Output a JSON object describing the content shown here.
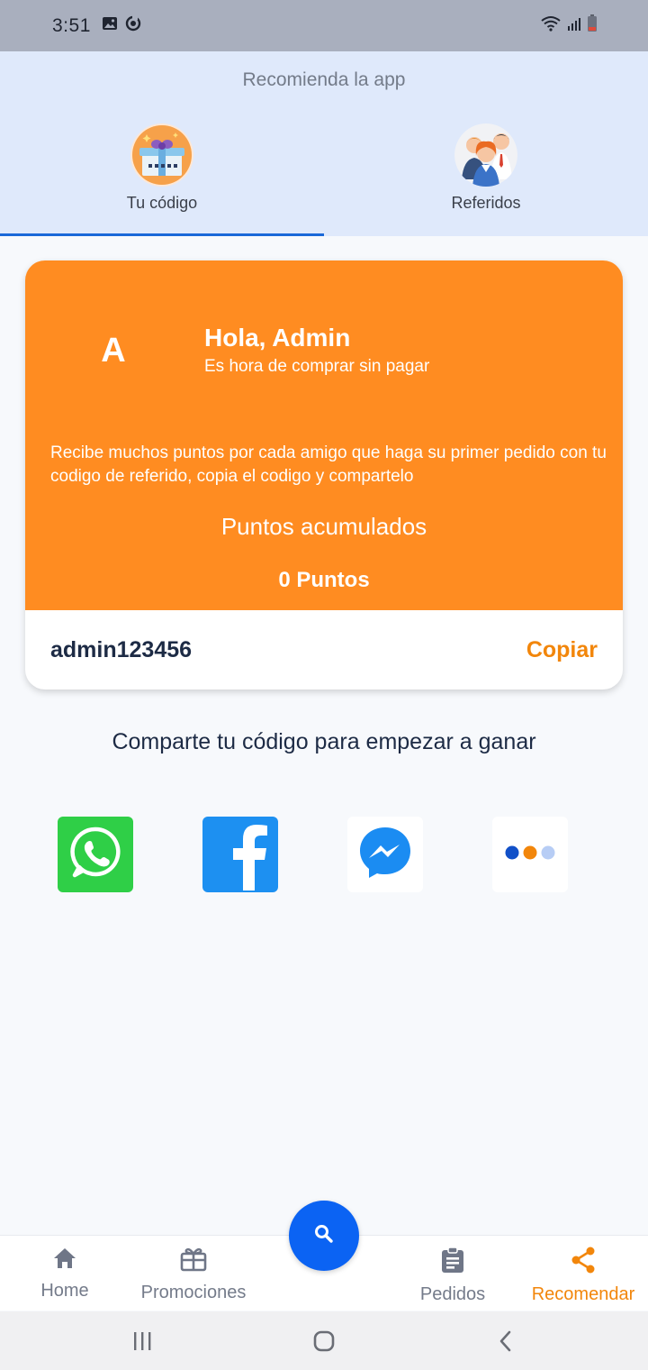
{
  "status_bar": {
    "time": "3:51",
    "icons": [
      "image-icon",
      "sync-icon",
      "wifi-icon",
      "signal-icon",
      "battery-icon"
    ]
  },
  "header": {
    "title": "Recomienda la app",
    "tabs": [
      {
        "label": "Tu código",
        "icon": "gift-icon",
        "active": true
      },
      {
        "label": "Referidos",
        "icon": "people-icon",
        "active": false
      }
    ],
    "indicator_color": "#1a68d8"
  },
  "card": {
    "avatar_letter": "A",
    "greeting": "Hola, Admin",
    "subgreeting": "Es hora de comprar sin pagar",
    "info": "Recibe muchos puntos por cada amigo que haga su primer pedido con tu codigo de referido, copia el codigo y compartelo",
    "points_label": "Puntos acumulados",
    "points_value": "0 Puntos",
    "referral_code": "admin123456",
    "copy_label": "Copiar",
    "accent_color": "#ff8c21"
  },
  "share": {
    "title": "Comparte tu código para empezar a ganar",
    "options": [
      "whatsapp-icon",
      "facebook-icon",
      "messenger-icon",
      "more-icon"
    ]
  },
  "bottom_nav": {
    "items": [
      {
        "label": "Home",
        "icon": "home-icon",
        "active": false
      },
      {
        "label": "Promociones",
        "icon": "gift-icon",
        "active": false
      },
      {
        "label": "Pedidos",
        "icon": "clipboard-icon",
        "active": false
      },
      {
        "label": "Recomendar",
        "icon": "share-icon",
        "active": true
      }
    ],
    "fab_icon": "search-icon",
    "active_color": "#f2860b",
    "fab_color": "#0b63f3"
  },
  "system_nav": {
    "buttons": [
      "recent-apps-icon",
      "home-circle-icon",
      "back-icon"
    ]
  }
}
